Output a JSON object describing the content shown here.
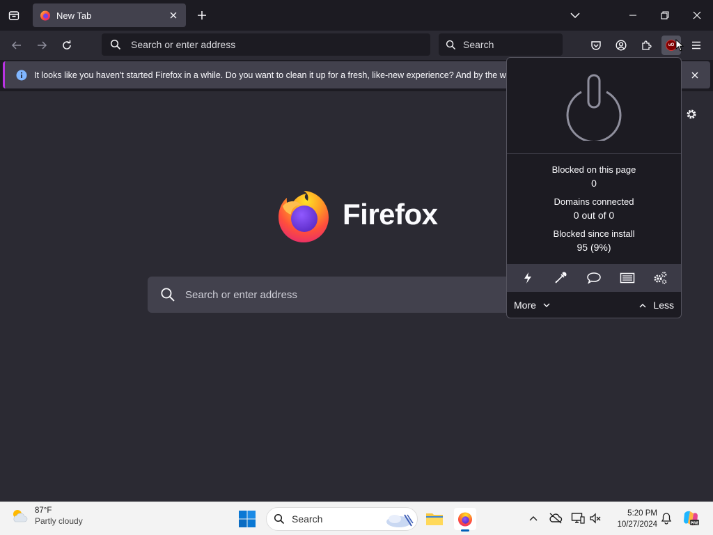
{
  "browser": {
    "tab": {
      "title": "New Tab"
    },
    "urlbar": {
      "placeholder": "Search or enter address"
    },
    "searchbar": {
      "placeholder": "Search"
    }
  },
  "notification": {
    "text": "It looks like you haven't started Firefox in a while. Do you want to clean it up for a fresh, like-new experience? And by the way, welcome back!"
  },
  "newtab": {
    "brand": "Firefox",
    "search_placeholder": "Search or enter address"
  },
  "ublock_popup": {
    "stats": [
      {
        "label": "Blocked on this page",
        "value": "0"
      },
      {
        "label": "Domains connected",
        "value": "0 out of 0"
      },
      {
        "label": "Blocked since install",
        "value": "95 (9%)"
      }
    ],
    "tools": [
      "lightning-icon",
      "eyedropper-icon",
      "speech-bubble-icon",
      "logger-icon",
      "gears-icon"
    ],
    "more_label": "More",
    "less_label": "Less"
  },
  "toolbar_icons": [
    "pocket-icon",
    "account-icon",
    "extensions-icon",
    "ublock-origin-icon",
    "menu-icon"
  ],
  "taskbar": {
    "weather": {
      "temp": "87°F",
      "condition": "Partly cloudy"
    },
    "search_label": "Search",
    "clock": {
      "time": "5:20 PM",
      "date": "10/27/2024"
    }
  },
  "colors": {
    "accent": "#b833e1",
    "background": "#2b2a33",
    "popup_background": "#1c1b22",
    "info_blue": "#80b6ff"
  }
}
